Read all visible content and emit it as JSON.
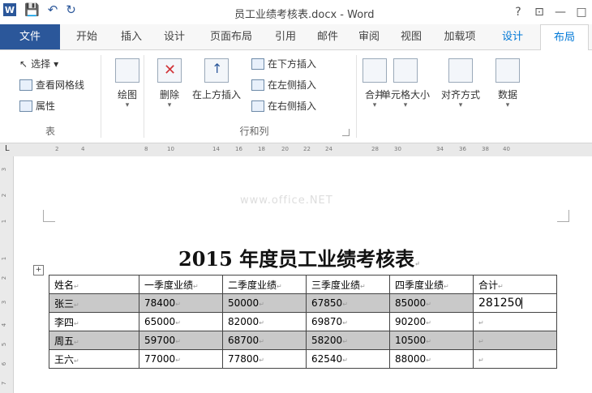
{
  "window": {
    "title": "员工业绩考核表.docx - Word",
    "controls": [
      "?",
      "⊡",
      "—",
      "□"
    ]
  },
  "quick_access": {
    "app_icon": "W",
    "save_icon": "save-icon",
    "undo_icon": "undo-icon",
    "redo_icon": "redo-icon"
  },
  "tabs": [
    {
      "label": "文件"
    },
    {
      "label": "开始"
    },
    {
      "label": "插入"
    },
    {
      "label": "设计"
    },
    {
      "label": "页面布局"
    },
    {
      "label": "引用"
    },
    {
      "label": "邮件"
    },
    {
      "label": "审阅"
    },
    {
      "label": "视图"
    },
    {
      "label": "加载项"
    },
    {
      "label": "设计"
    },
    {
      "label": "布局"
    }
  ],
  "ribbon": {
    "table_group": {
      "select": "选择",
      "view_gridlines": "查看网格线",
      "properties": "属性",
      "label": "表"
    },
    "draw": "绘图",
    "delete": "删除",
    "insert_above": "在上方插入",
    "insert_below": "在下方插入",
    "insert_left": "在左侧插入",
    "insert_right": "在右侧插入",
    "rows_cols_label": "行和列",
    "merge": "合并",
    "cell_size": "单元格大小",
    "alignment": "对齐方式",
    "data": "数据"
  },
  "ruler": {
    "corner": "L",
    "ticks": [
      "2",
      "4",
      "8",
      "10",
      "14",
      "16",
      "18",
      "20",
      "22",
      "24",
      "28",
      "30",
      "34",
      "36",
      "38",
      "40"
    ],
    "vertical_ticks": [
      "3",
      "2",
      "1",
      "1",
      "2",
      "3",
      "4",
      "5",
      "6",
      "7"
    ]
  },
  "document": {
    "watermark": "www.office.NET",
    "title": "2015 年度员工业绩考核表",
    "headers": [
      "姓名",
      "一季度业绩",
      "二季度业绩",
      "三季度业绩",
      "四季度业绩",
      "合计"
    ],
    "rows": [
      {
        "name": "张三",
        "q1": "78400",
        "q2": "50000",
        "q3": "67850",
        "q4": "85000",
        "total": "281250"
      },
      {
        "name": "李四",
        "q1": "65000",
        "q2": "82000",
        "q3": "69870",
        "q4": "90200",
        "total": ""
      },
      {
        "name": "周五",
        "q1": "59700",
        "q2": "68700",
        "q3": "58200",
        "q4": "10500",
        "total": ""
      },
      {
        "name": "王六",
        "q1": "77000",
        "q2": "77800",
        "q3": "62540",
        "q4": "88000",
        "total": ""
      }
    ]
  },
  "colors": {
    "accent": "#2b579a",
    "context_tab": "#0078d7",
    "shaded_row": "#c9c9c9"
  }
}
